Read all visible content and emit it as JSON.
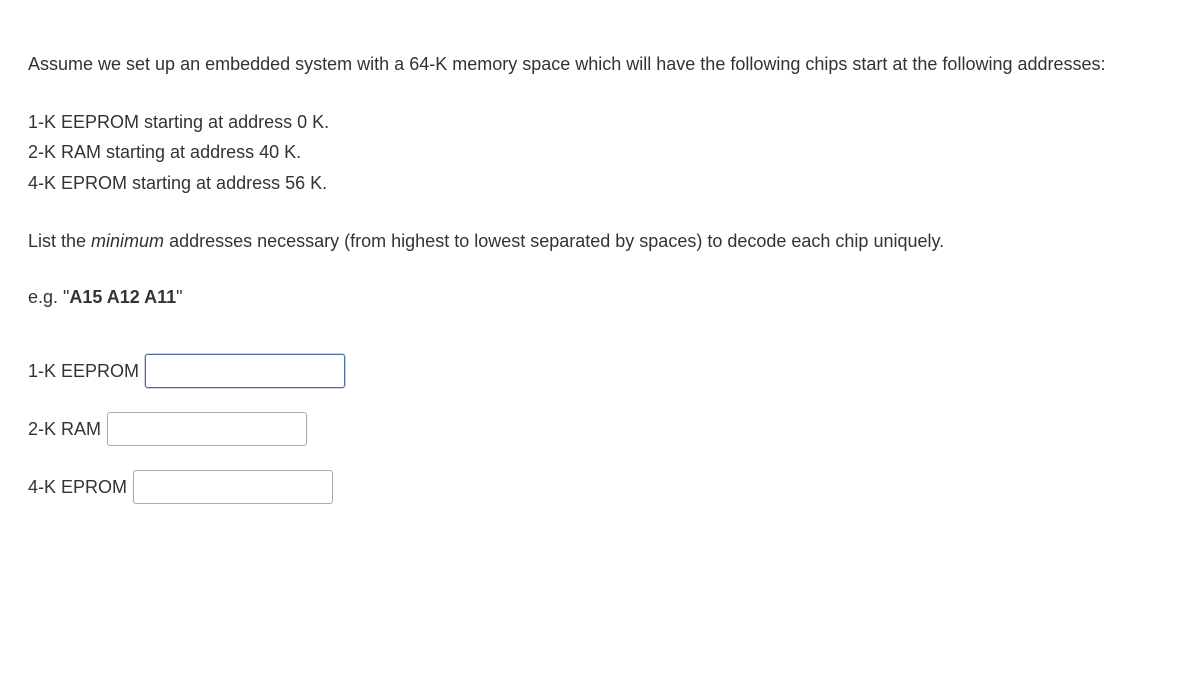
{
  "intro": "Assume we set up an embedded system with a 64-K memory space which will have the following chips start at the following addresses:",
  "chips": [
    "1-K EEPROM starting at address 0 K.",
    "2-K RAM starting at address 40 K.",
    "4-K EPROM starting at address 56 K."
  ],
  "instruction_pre": "List the ",
  "instruction_em": "minimum",
  "instruction_post": " addresses necessary (from highest to lowest separated by spaces) to decode each chip uniquely.",
  "example_pre": "e.g. \"",
  "example_bold": "A15 A12 A11",
  "example_post": "\"",
  "answers": [
    {
      "label": "1-K EEPROM",
      "value": "",
      "focused": true
    },
    {
      "label": "2-K RAM",
      "value": "",
      "focused": false
    },
    {
      "label": "4-K EPROM",
      "value": "",
      "focused": false
    }
  ]
}
